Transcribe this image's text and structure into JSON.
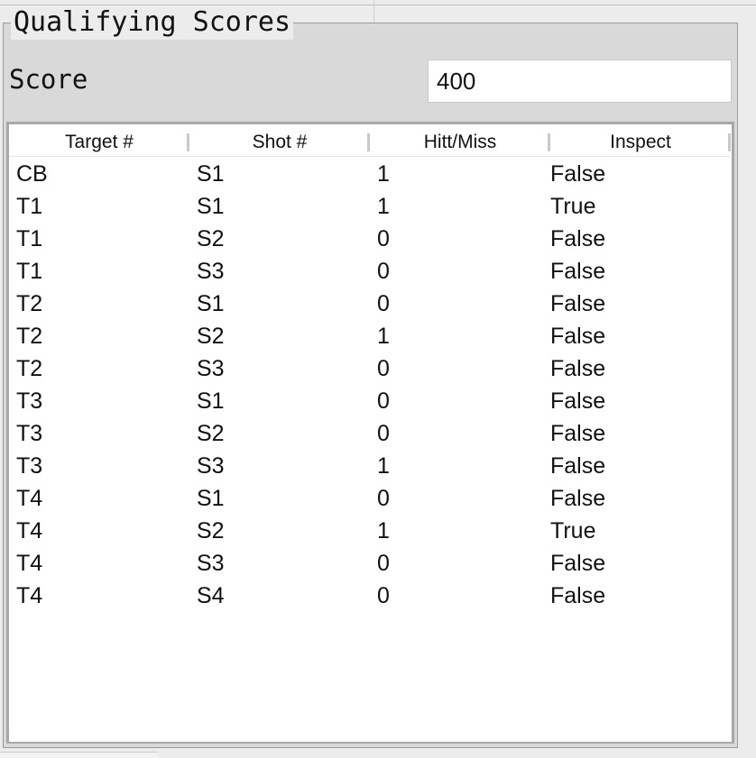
{
  "group": {
    "title": "Qualifying Scores"
  },
  "score": {
    "label": "Score",
    "value": "400"
  },
  "table": {
    "columns": [
      "Target #",
      "Shot #",
      "Hitt/Miss",
      "Inspect"
    ],
    "rows": [
      [
        "CB",
        "S1",
        "1",
        "False"
      ],
      [
        "T1",
        "S1",
        "1",
        "True"
      ],
      [
        "T1",
        "S2",
        "0",
        "False"
      ],
      [
        "T1",
        "S3",
        "0",
        "False"
      ],
      [
        "T2",
        "S1",
        "0",
        "False"
      ],
      [
        "T2",
        "S2",
        "1",
        "False"
      ],
      [
        "T2",
        "S3",
        "0",
        "False"
      ],
      [
        "T3",
        "S1",
        "0",
        "False"
      ],
      [
        "T3",
        "S2",
        "0",
        "False"
      ],
      [
        "T3",
        "S3",
        "1",
        "False"
      ],
      [
        "T4",
        "S1",
        "0",
        "False"
      ],
      [
        "T4",
        "S2",
        "1",
        "True"
      ],
      [
        "T4",
        "S3",
        "0",
        "False"
      ],
      [
        "T4",
        "S4",
        "0",
        "False"
      ]
    ]
  }
}
